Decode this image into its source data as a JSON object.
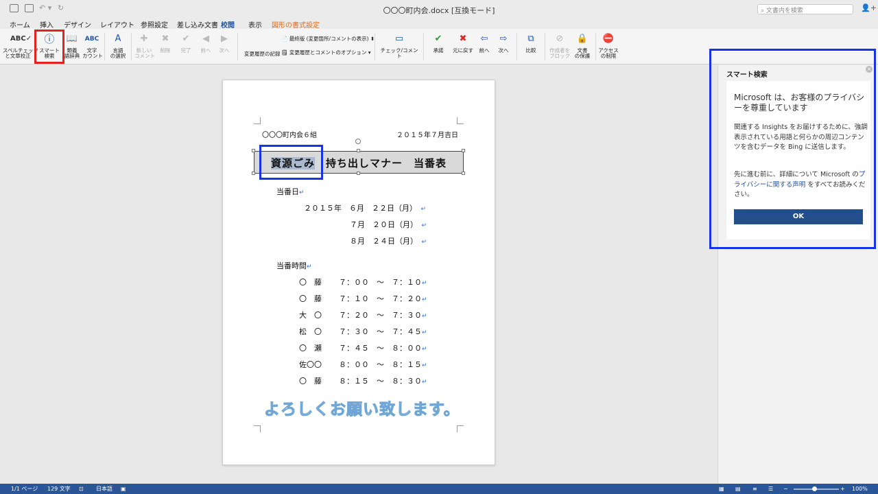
{
  "window": {
    "title": "〇〇〇町内会.docx [互換モード]",
    "search_placeholder": "文書内を検索"
  },
  "tabs": [
    "ホーム",
    "挿入",
    "デザイン",
    "レイアウト",
    "参照設定",
    "差し込み文書",
    "校閲",
    "表示",
    "図形の書式設定"
  ],
  "ribbon": {
    "spell": "スペルチェック\nと文章校正",
    "smart": "スマート\n検索",
    "thesaurus": "類義\n語辞典",
    "wordcount": "文字\nカウント",
    "language": "言語\nの選択",
    "newcomment": "新しい\nコメント",
    "delete": "削除",
    "done": "完了",
    "prev": "前へ",
    "next": "次へ",
    "track_toggle": "オフ",
    "track_label": "変更履歴の記録",
    "display_select": "最終版 (変更箇所/コメントの表示)",
    "markup_options": "変更履歴とコメントのオプション",
    "check": "チェック/コメント",
    "accept": "承諾",
    "reject": "元に戻す",
    "prev2": "前へ",
    "next2": "次へ",
    "compare": "比較",
    "block": "作成者を\nブロック",
    "protect": "文書\nの保護",
    "restrict": "アクセス\nの制限"
  },
  "doc": {
    "group": "〇〇〇町内会６組",
    "date": "２０１５年７月吉日",
    "title_hl": "資源ごみ",
    "title_rest": "持ち出しマナー　当番表",
    "duty_day_label": "当番日",
    "days": [
      "２０１５年　６月　２２日（月）",
      "７月　２０日（月）",
      "８月　２４日（月）"
    ],
    "duty_time_label": "当番時間",
    "rows": [
      [
        "〇　藤",
        "７：００　～　７：１０"
      ],
      [
        "〇　藤",
        "７：１０　～　７：２０"
      ],
      [
        "大　〇",
        "７：２０　～　７：３０"
      ],
      [
        "松　〇",
        "７：３０　～　７：４５"
      ],
      [
        "〇　瀬",
        "７：４５　～　８：００"
      ],
      [
        "佐〇〇",
        "８：００　～　８：１５"
      ],
      [
        "〇　藤",
        "８：１５　～　８：３０"
      ]
    ],
    "closing": "よろしくお願い致します。",
    "para_mark": "↵"
  },
  "pane": {
    "title": "スマート検索",
    "close": "×",
    "heading": "Microsoft は、お客様のプライバシーを尊重しています",
    "p1": "関連する Insights をお届けするために、強調表示されている用語と何らかの周辺コンテンツを含むデータを Bing に送信します。",
    "p2a": "先に進む前に、詳細について Microsoft の",
    "p2link": "プライバシーに関する声明",
    "p2b": " をすべてお読みください。",
    "ok": "OK"
  },
  "status": {
    "page": "1/1 ページ",
    "words": "129 文字",
    "lang": "日本語",
    "zoom": "100%"
  }
}
